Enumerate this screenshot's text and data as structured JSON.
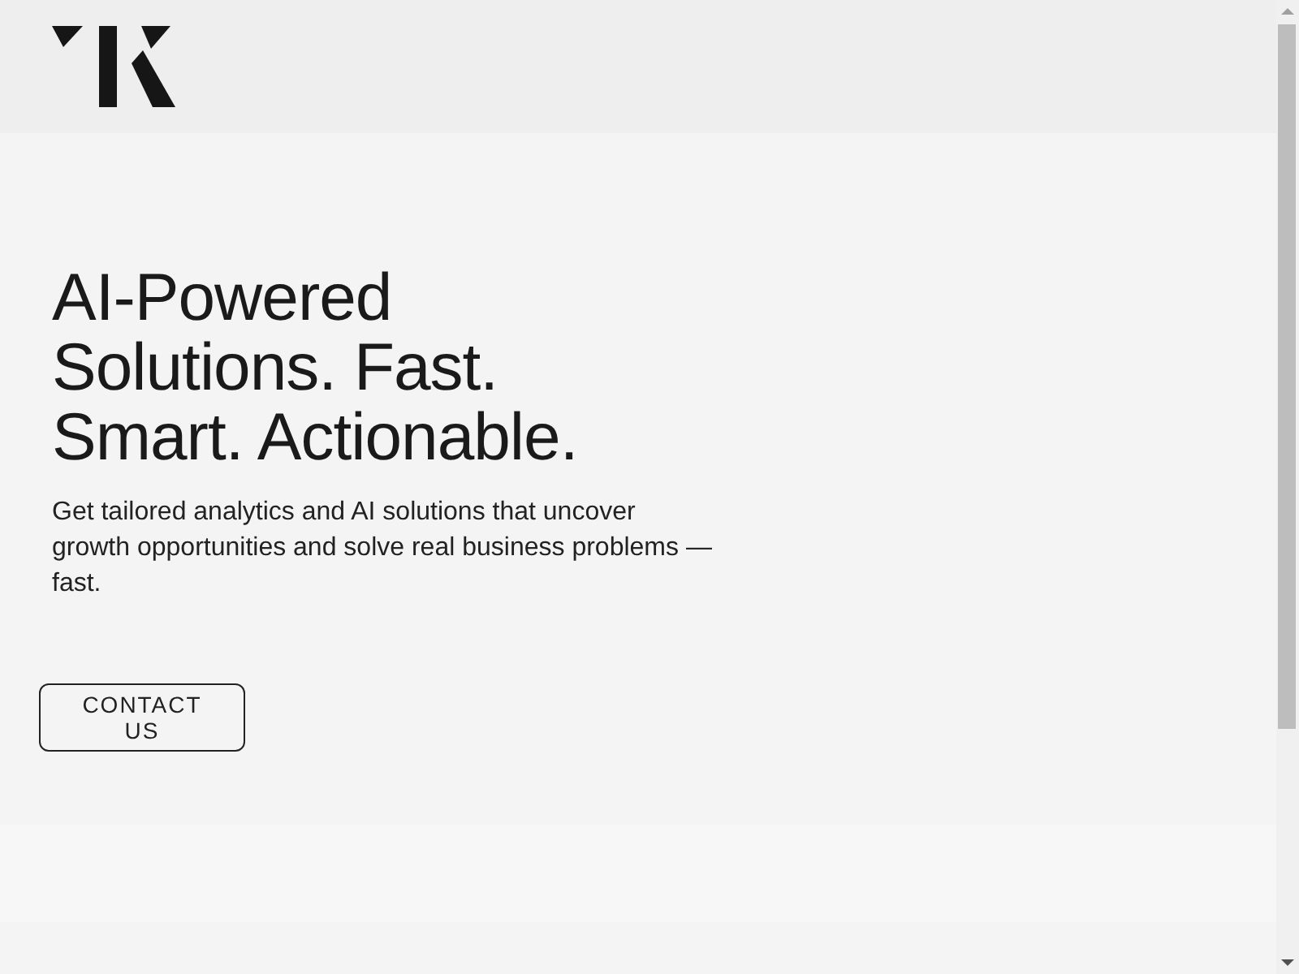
{
  "hero": {
    "heading": "AI-Powered Solutions. Fast. Smart. Actionable.",
    "text": "Get tailored analytics and AI solutions that uncover growth opportunities and solve real business problems — fast.",
    "button": "CONTACT US"
  }
}
